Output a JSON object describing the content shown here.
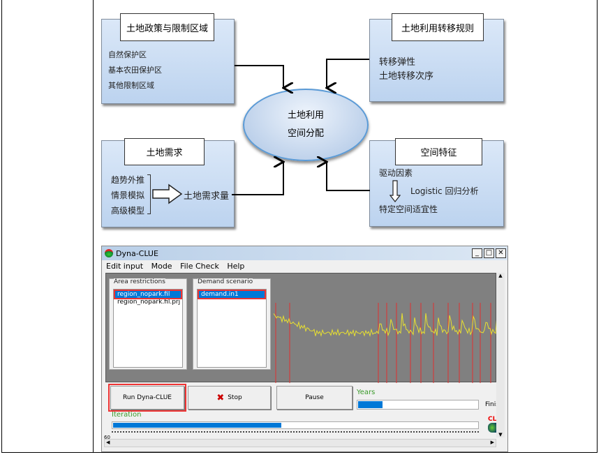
{
  "diagram": {
    "policy": {
      "title": "土地政策与限制区域",
      "items": [
        "自然保护区",
        "基本农田保护区",
        "其他限制区域"
      ]
    },
    "rules": {
      "title": "土地利用转移规则",
      "items": [
        "转移弹性",
        "土地转移次序"
      ]
    },
    "center": {
      "line1": "土地利用",
      "line2": "空间分配"
    },
    "demand": {
      "title": "土地需求",
      "items": [
        "趋势外推",
        "情景模拟",
        "高级模型"
      ],
      "result": "土地需求量"
    },
    "spatial": {
      "title": "空间特征",
      "from": "驱动因素",
      "method": "Logistic 回归分析",
      "to": "特定空间适宜性"
    }
  },
  "window": {
    "title": "Dyna-CLUE",
    "menu": [
      "Edit input",
      "Mode",
      "File Check",
      "Help"
    ],
    "area_restrictions": {
      "label": "Area restrictions",
      "items": [
        "region_nopark.fil",
        "region_nopark.fil.prj"
      ],
      "selected": 0
    },
    "demand_scenario": {
      "label": "Demand scenario",
      "items": [
        "demand.in1"
      ],
      "selected": 0
    },
    "buttons": {
      "run": "Run Dyna-CLUE",
      "stop": "Stop",
      "pause": "Pause"
    },
    "years_label": "Years",
    "years_progress": 0.2,
    "finish_label": "Finis",
    "iteration_label": "Iteration",
    "iteration_progress": 0.46,
    "logo_text": "CL",
    "scroll_text": "60",
    "colors": {
      "accent": "#0078d7",
      "highlight": "#e53935",
      "label_green": "#3a9a2a",
      "plot_bg": "#808080"
    }
  }
}
